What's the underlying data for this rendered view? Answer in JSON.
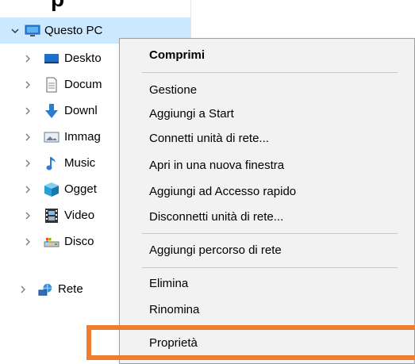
{
  "header": {
    "text": "p"
  },
  "nav": {
    "items": [
      {
        "label": "Questo PC",
        "icon": "computer-icon",
        "expanded": true
      },
      {
        "label": "Deskto",
        "icon": "desktop-icon"
      },
      {
        "label": "Docum",
        "icon": "documents-icon"
      },
      {
        "label": "Downl",
        "icon": "downloads-icon"
      },
      {
        "label": "Immag",
        "icon": "pictures-icon"
      },
      {
        "label": "Music",
        "icon": "music-icon"
      },
      {
        "label": "Ogget",
        "icon": "3d-objects-icon"
      },
      {
        "label": "Video",
        "icon": "videos-icon"
      },
      {
        "label": "Disco",
        "icon": "local-disk-icon"
      },
      {
        "label": "Rete",
        "icon": "network-icon"
      }
    ]
  },
  "context_menu": {
    "items": [
      {
        "label": "Comprimi"
      },
      {
        "label": "Gestione"
      },
      {
        "label": "Aggiungi a Start"
      },
      {
        "label": "Connetti unità di rete..."
      },
      {
        "label": "Apri in una nuova finestra"
      },
      {
        "label": "Aggiungi ad Accesso rapido"
      },
      {
        "label": "Disconnetti unità di rete..."
      },
      {
        "label": "Aggiungi percorso di rete"
      },
      {
        "label": "Elimina"
      },
      {
        "label": "Rinomina"
      },
      {
        "label": "Proprietà"
      }
    ]
  },
  "colors": {
    "selection": "#cce8ff",
    "menu_background": "#f2f2f2",
    "highlight_outline": "#ed7d31"
  }
}
